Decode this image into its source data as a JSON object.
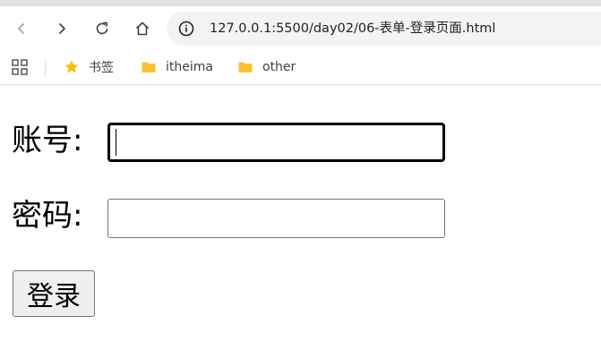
{
  "browser": {
    "url": "127.0.0.1:5500/day02/06-表单-登录页面.html",
    "bookmarks": [
      {
        "label": "书签",
        "icon": "star-icon"
      },
      {
        "label": "itheima",
        "icon": "folder-icon"
      },
      {
        "label": "other",
        "icon": "folder-icon"
      }
    ]
  },
  "form": {
    "account_label": "账号:",
    "account_value": "",
    "password_label": "密码:",
    "password_value": "",
    "submit_label": "登录"
  },
  "colors": {
    "bookmark_star": "#fbbc04",
    "folder": "#f9c22e",
    "omnibox_bg": "#f1f3f4"
  }
}
